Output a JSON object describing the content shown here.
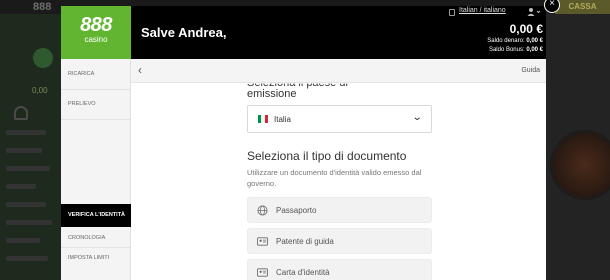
{
  "background": {
    "logo": "888",
    "cassa_label": "CASSA",
    "balance": "0,00"
  },
  "header": {
    "logo_main": "888",
    "logo_sub": "casino",
    "greeting": "Salve Andrea,",
    "language": "Italian / italiano",
    "balance": "0,00 €",
    "saldo_denaro_label": "Saldo denaro:",
    "saldo_denaro_value": "0,00 €",
    "saldo_bonus_label": "Saldo Bonus:",
    "saldo_bonus_value": "0,00 €"
  },
  "sidebar": {
    "items": [
      {
        "label": "RICARICA"
      },
      {
        "label": "PRELIEVO"
      },
      {
        "label": "VERIFICA L'IDENTITÀ",
        "active": true
      },
      {
        "label": "CRONOLOGIA"
      },
      {
        "label": "IMPOSTA LIMITI"
      }
    ]
  },
  "subbar": {
    "guide_label": "Guida"
  },
  "main": {
    "partial_heading": "Seleziona il paese di",
    "emission_label": "emissione",
    "country_select": {
      "value": "Italia"
    },
    "doc_title": "Seleziona il tipo di documento",
    "doc_description": "Utilizzare un documento d'identità valido emesso dal governo.",
    "options": [
      {
        "label": "Passaporto",
        "icon": "globe-icon"
      },
      {
        "label": "Patente di guida",
        "icon": "id-card-icon"
      },
      {
        "label": "Carta d'identità",
        "icon": "id-card-icon"
      }
    ]
  },
  "colors": {
    "brand_green": "#62b531",
    "header_black": "#000000",
    "flag_green": "#009246",
    "flag_white": "#ffffff",
    "flag_red": "#ce2b37"
  },
  "close_label": "×"
}
